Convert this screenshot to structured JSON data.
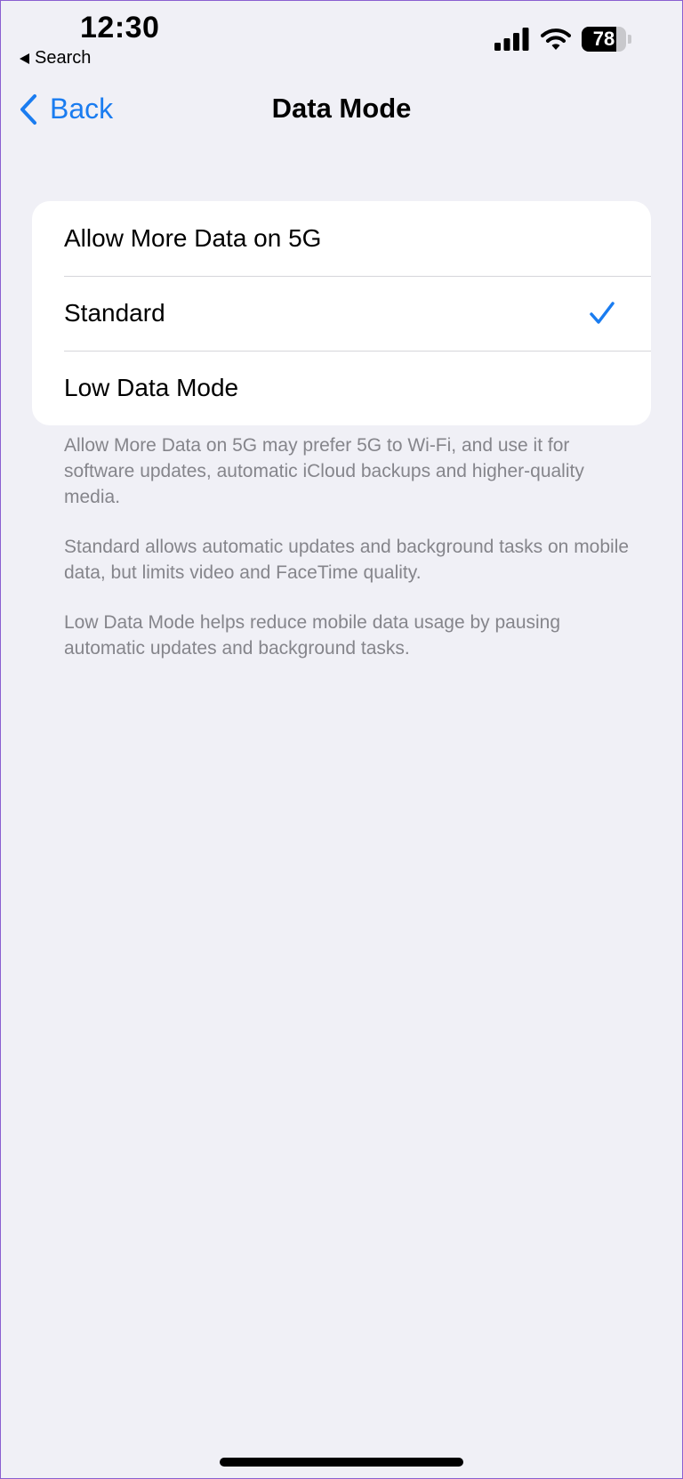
{
  "status_bar": {
    "time": "12:30",
    "back_app": "Search",
    "battery_level": "78",
    "battery_fraction": 0.78
  },
  "nav": {
    "back_label": "Back",
    "title": "Data Mode"
  },
  "options": [
    {
      "label": "Allow More Data on 5G",
      "selected": false
    },
    {
      "label": "Standard",
      "selected": true
    },
    {
      "label": "Low Data Mode",
      "selected": false
    }
  ],
  "notes": [
    "Allow More Data on 5G may prefer 5G to Wi-Fi, and use it for software updates, automatic iCloud backups and higher-quality media.",
    "Standard allows automatic updates and background tasks on mobile data, but limits video and FaceTime quality.",
    "Low Data Mode helps reduce mobile data usage by pausing automatic updates and background tasks."
  ],
  "colors": {
    "accent": "#1a7cf0",
    "background": "#f0f0f6",
    "secondary_text": "#85858b"
  },
  "icons": {
    "back": "chevron-left-icon",
    "selected": "checkmark-icon",
    "signal": "cellular-signal-icon",
    "wifi": "wifi-icon",
    "battery": "battery-icon"
  }
}
